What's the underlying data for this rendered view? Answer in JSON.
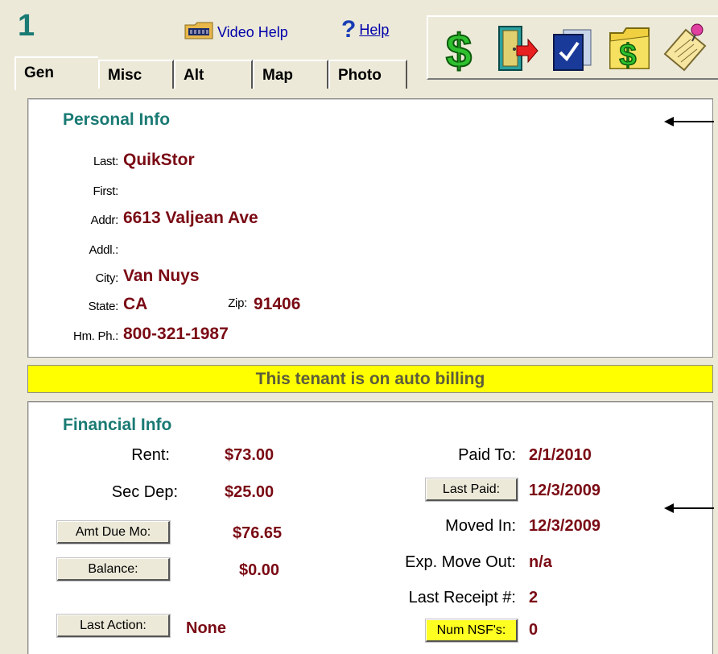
{
  "header": {
    "unit_number": "1",
    "video_help_label": "Video Help",
    "help_label": "Help"
  },
  "toolbar": {
    "icons": [
      "payment-icon",
      "move-out-icon",
      "documents-icon",
      "billing-folder-icon",
      "notes-icon"
    ]
  },
  "tabs": [
    {
      "label": "Gen",
      "active": true
    },
    {
      "label": "Misc",
      "active": false
    },
    {
      "label": "Alt",
      "active": false
    },
    {
      "label": "Map",
      "active": false
    },
    {
      "label": "Photo",
      "active": false
    }
  ],
  "personal_info": {
    "title": "Personal Info",
    "last_label": "Last:",
    "last_value": "QuikStor",
    "first_label": "First:",
    "first_value": "",
    "addr_label": "Addr:",
    "addr_value": "6613 Valjean Ave",
    "addl_label": "Addl.:",
    "addl_value": "",
    "city_label": "City:",
    "city_value": "Van Nuys",
    "state_label": "State:",
    "state_value": "CA",
    "zip_label": "Zip:",
    "zip_value": "91406",
    "phone_label": "Hm. Ph.:",
    "phone_value": "800-321-1987"
  },
  "banner": {
    "auto_billing": "This tenant is on auto billing"
  },
  "financial_info": {
    "title": "Financial Info",
    "rent_label": "Rent:",
    "rent_value": "$73.00",
    "sec_dep_label": "Sec Dep:",
    "sec_dep_value": "$25.00",
    "amt_due_label": "Amt Due Mo:",
    "amt_due_value": "$76.65",
    "balance_label": "Balance:",
    "balance_value": "$0.00",
    "last_action_label": "Last Action:",
    "last_action_value": "None",
    "paid_to_label": "Paid To:",
    "paid_to_value": "2/1/2010",
    "last_paid_label": "Last Paid:",
    "last_paid_value": "12/3/2009",
    "moved_in_label": "Moved In:",
    "moved_in_value": "12/3/2009",
    "exp_move_out_label": "Exp. Move Out:",
    "exp_move_out_value": "n/a",
    "last_receipt_label": "Last Receipt #:",
    "last_receipt_value": "2",
    "num_nsf_label": "Num NSF's:",
    "num_nsf_value": "0"
  },
  "colors": {
    "background": "#ece9d8",
    "section_title": "#1a7a74",
    "value_text": "#7a0a14",
    "banner": "#ffff00"
  }
}
